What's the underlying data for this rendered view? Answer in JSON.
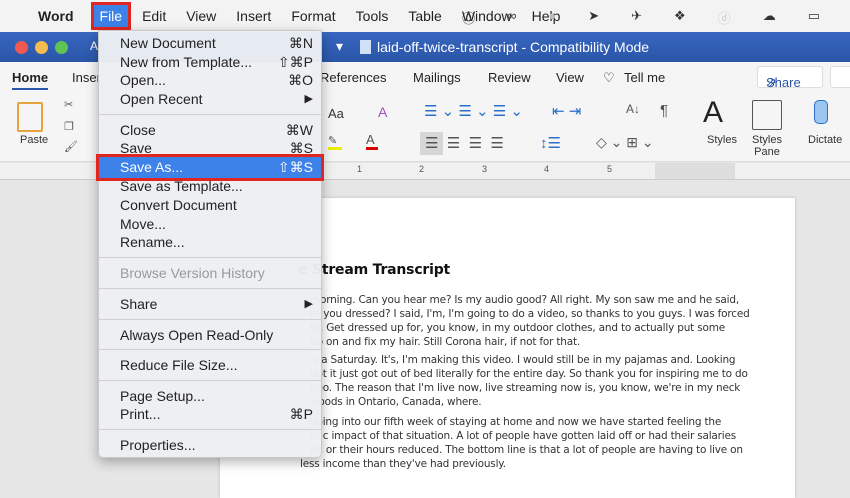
{
  "menubar": {
    "apple": "",
    "app": "Word",
    "items": [
      "File",
      "Edit",
      "View",
      "Insert",
      "Format",
      "Tools",
      "Table",
      "Window",
      "Help"
    ]
  },
  "tray_icons": [
    "1password-icon",
    "creative-cloud-icon",
    "shield-icon",
    "arrows-icon",
    "rocket-icon",
    "dropbox-icon",
    "d-icon",
    "cloud-icon",
    "display-icon"
  ],
  "titlebar": {
    "autosave_partial": "A",
    "doc_title": "laid-off-twice-transcript  -  Compatibility Mode"
  },
  "ribbon_tabs": [
    "Home",
    "Inser",
    "References",
    "Mailings",
    "Review",
    "View"
  ],
  "tell_me": "Tell me",
  "share": "Share",
  "ribbon": {
    "paste": "Paste",
    "aa": "Aa",
    "styles": "Styles",
    "styles_pane": "Styles Pane",
    "dictate": "Dictate"
  },
  "ruler": [
    "1",
    "2",
    "3",
    "4",
    "5",
    "6"
  ],
  "file_menu": [
    {
      "label": "New Document",
      "shortcut": "⌘N"
    },
    {
      "label": "New from Template...",
      "shortcut": "⇧⌘P"
    },
    {
      "label": "Open...",
      "shortcut": "⌘O"
    },
    {
      "label": "Open Recent",
      "shortcut": "▶"
    },
    {
      "sep": true
    },
    {
      "label": "Close",
      "shortcut": "⌘W"
    },
    {
      "label": "Save",
      "shortcut": "⌘S"
    },
    {
      "label": "Save As...",
      "shortcut": "⇧⌘S",
      "highlighted": true
    },
    {
      "label": "Save as Template..."
    },
    {
      "label": "Convert Document"
    },
    {
      "label": "Move..."
    },
    {
      "label": "Rename..."
    },
    {
      "sep": true
    },
    {
      "label": "Browse Version History",
      "disabled": true
    },
    {
      "sep": true
    },
    {
      "label": "Share",
      "shortcut": "▶"
    },
    {
      "sep": true
    },
    {
      "label": "Always Open Read-Only"
    },
    {
      "sep": true
    },
    {
      "label": "Reduce File Size..."
    },
    {
      "sep": true
    },
    {
      "label": "Page Setup..."
    },
    {
      "label": "Print...",
      "shortcut": "⌘P"
    },
    {
      "sep": true
    },
    {
      "label": "Properties..."
    }
  ],
  "document": {
    "heading": "e Stream Transcript",
    "lines": [
      "morning. Can you hear me? Is my audio good? All right. My son saw me and he said,",
      "re you dressed? I said, I'm, I'm going to do a video, so thanks to you guys. I was forced",
      "to. Get dressed up for, you know, in my outdoor clothes, and to actually put some",
      "up on and fix my hair. Still Corona hair, if not for that.",
      "'s a Saturday. It's, I'm making this video. I would still be in my pajamas and. Looking",
      "got it just got out of bed literally for the entire day. So thank you for inspiring me to do",
      "deo. The reason that I'm  live now, live streaming now is, you know, we're in my neck",
      "woods in Ontario, Canada, where.",
      "going into our fifth week of staying at home and now we have started feeling the",
      "mic impact of that situation. A lot of people have gotten laid off or had their salaries",
      "ed or their hours reduced. The bottom line is that a lot of people are having to live on",
      "less income than they've had previously."
    ]
  },
  "colors": {
    "title_bar": "#2a55a8",
    "highlight": "#3d82e8",
    "callout": "#e0271f"
  }
}
